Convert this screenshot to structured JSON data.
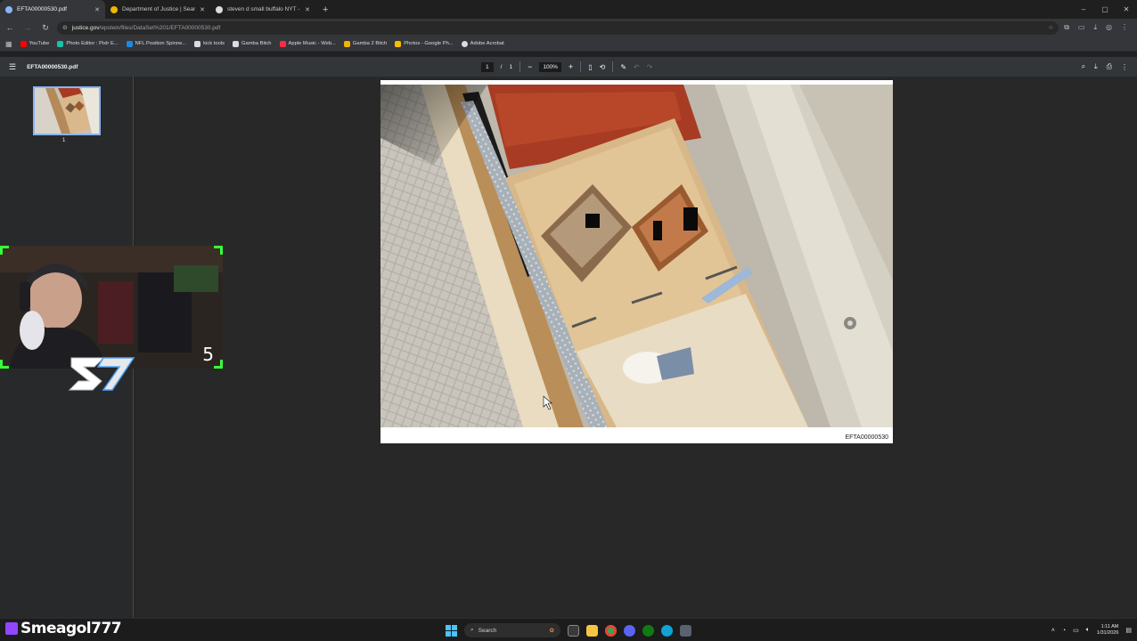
{
  "browser": {
    "tabs": [
      {
        "title": "EFTA00000530.pdf",
        "active": true,
        "favicon_color": "#8ab4f8"
      },
      {
        "title": "Department of Justice | Search",
        "active": false,
        "favicon_color": "#f0b400"
      },
      {
        "title": "steven d small buffalo NYT - G",
        "active": false,
        "favicon_color": "#dadce0"
      }
    ],
    "new_tab_label": "+",
    "window_controls": {
      "minimize": "–",
      "restore": "▢",
      "close": "✕"
    },
    "address": {
      "host": "justice.gov",
      "path": "/epstein/files/DataSet%201/EFTA00000530.pdf"
    },
    "nav": {
      "back": "←",
      "forward": "→",
      "reload": "↻"
    },
    "bookmarks": [
      {
        "label": "YouTube",
        "color": "#ff0000"
      },
      {
        "label": "Photo Editor : Pixlr E...",
        "color": "#19c3a6"
      },
      {
        "label": "NFL Position Spinne...",
        "color": "#1e88e5"
      },
      {
        "label": "kick tools",
        "color": "#dadce0"
      },
      {
        "label": "Gamba Bitch",
        "color": "#dadce0"
      },
      {
        "label": "Apple Music - Web...",
        "color": "#fa2d48"
      },
      {
        "label": "Gamba 2 Bitch",
        "color": "#f0b400"
      },
      {
        "label": "Photos - Google Ph...",
        "color": "#fbbc04"
      },
      {
        "label": "Adobe Acrobat",
        "color": "#dadce0"
      }
    ]
  },
  "pdf": {
    "menu_icon": "☰",
    "filename": "EFTA00000530.pdf",
    "page_current": "1",
    "page_sep": "/",
    "page_total": "1",
    "zoom_out": "−",
    "zoom": "100%",
    "zoom_in": "+",
    "thumbnail_number": "1",
    "bates_number": "EFTA00000530"
  },
  "stream": {
    "streamer_name": "Smeagol777",
    "counter": "5"
  },
  "taskbar": {
    "search_placeholder": "Search",
    "time": "1:11 AM",
    "date": "1/31/2026"
  },
  "colors": {
    "accent": "#8ab4f8",
    "cam_border": "#3bff3b",
    "twitch": "#9146ff"
  }
}
